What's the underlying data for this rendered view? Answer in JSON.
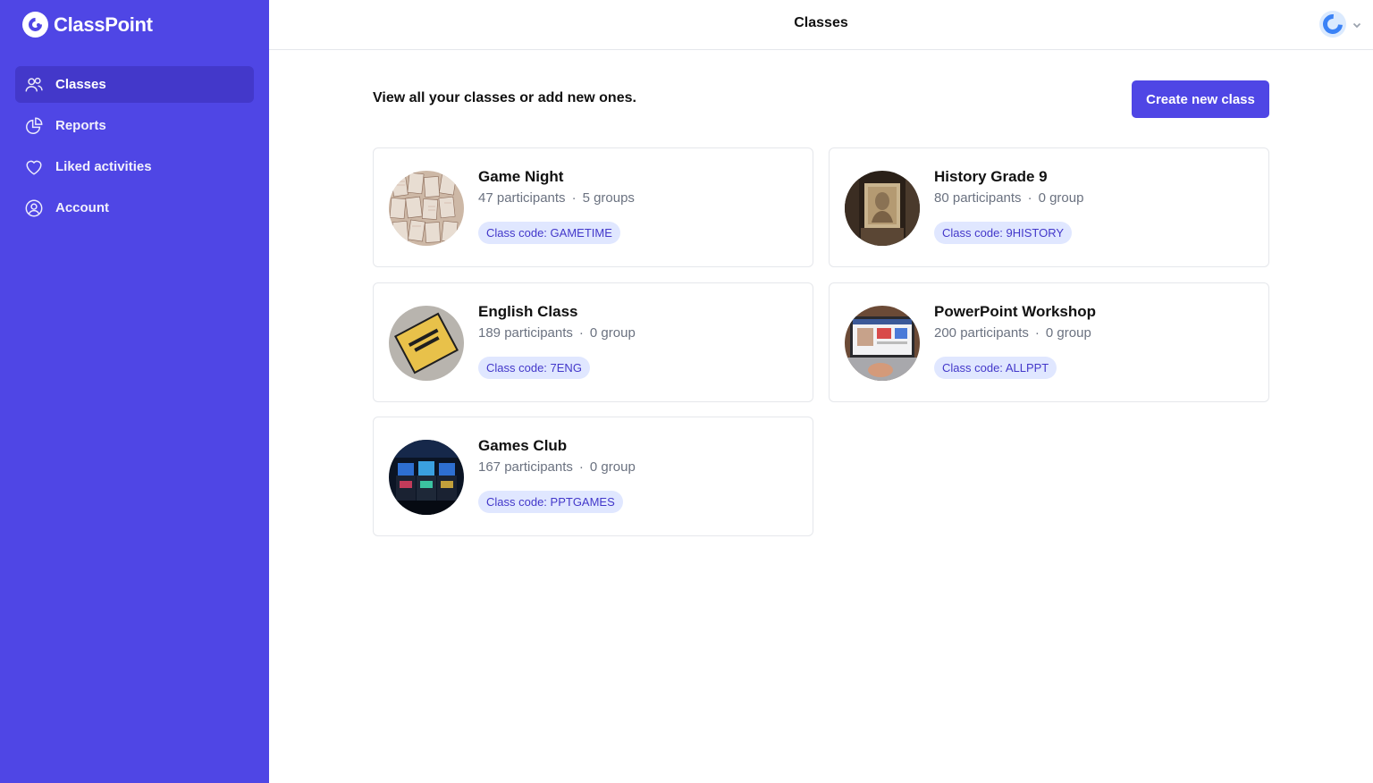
{
  "app": {
    "brand": "ClassPoint",
    "accent": "#4f46e5"
  },
  "sidebar": {
    "items": [
      {
        "label": "Classes",
        "icon": "users-icon",
        "active": true
      },
      {
        "label": "Reports",
        "icon": "pie-chart-icon"
      },
      {
        "label": "Liked activities",
        "icon": "heart-icon"
      },
      {
        "label": "Account",
        "icon": "user-circle-icon"
      }
    ]
  },
  "header": {
    "title": "Classes"
  },
  "main": {
    "intro": "View all your classes or add new ones.",
    "create_label": "Create new class",
    "classes": [
      {
        "name": "Game Night",
        "participants": "47 participants",
        "groups": "5 groups",
        "code": "Class code: GAMETIME"
      },
      {
        "name": "History Grade 9",
        "participants": "80 participants",
        "groups": "0 group",
        "code": "Class code: 9HISTORY"
      },
      {
        "name": "English Class",
        "participants": "189 participants",
        "groups": "0 group",
        "code": "Class code: 7ENG"
      },
      {
        "name": "PowerPoint Workshop",
        "participants": "200 participants",
        "groups": "0 group",
        "code": "Class code: ALLPPT"
      },
      {
        "name": "Games Club",
        "participants": "167 participants",
        "groups": "0 group",
        "code": "Class code: PPTGAMES"
      }
    ]
  }
}
